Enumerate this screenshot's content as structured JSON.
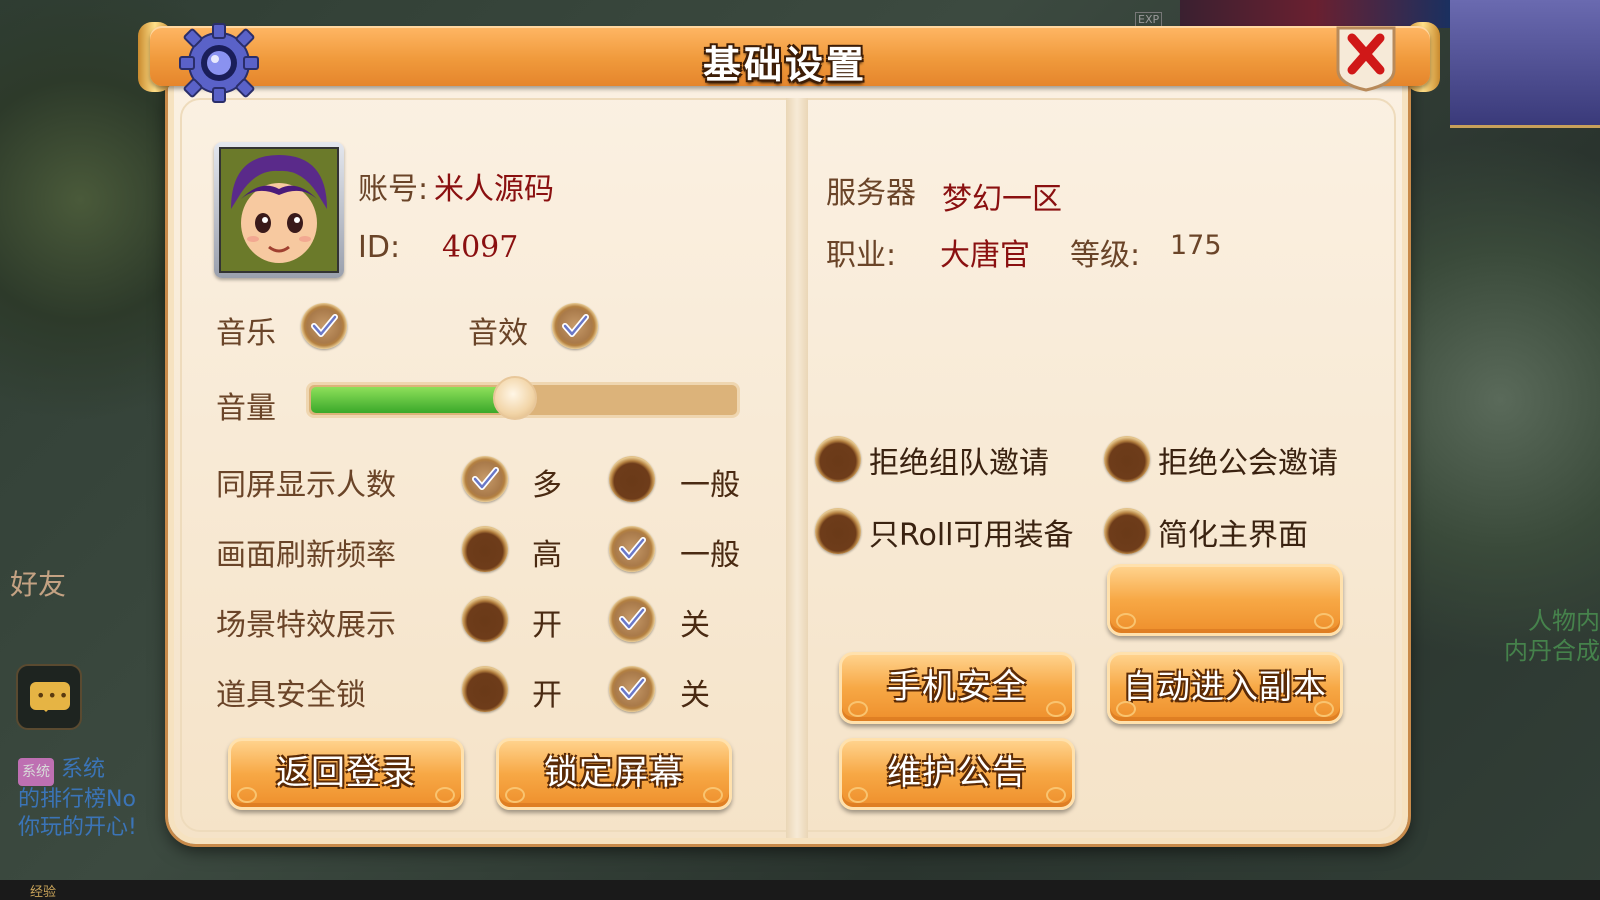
{
  "dialog": {
    "title": "基础设置",
    "close_icon": "close-icon",
    "gear_icon": "gear-icon"
  },
  "account": {
    "account_label": "账号:",
    "account_name": "米人源码",
    "id_label": "ID:",
    "id_value": "4097"
  },
  "server_info": {
    "server_label": "服务器",
    "server_value": "梦幻一区",
    "class_label": "职业:",
    "class_value": "大唐官",
    "level_label": "等级:",
    "level_value": "175"
  },
  "sound": {
    "music_label": "音乐",
    "music_checked": true,
    "sfx_label": "音效",
    "sfx_checked": true,
    "volume_label": "音量",
    "volume_level": 0.48
  },
  "settings_rows": [
    {
      "label": "同屏显示人数",
      "options": [
        {
          "text": "多",
          "checked": true
        },
        {
          "text": "一般",
          "checked": false
        }
      ]
    },
    {
      "label": "画面刷新频率",
      "options": [
        {
          "text": "高",
          "checked": false
        },
        {
          "text": "一般",
          "checked": true
        }
      ]
    },
    {
      "label": "场景特效展示",
      "options": [
        {
          "text": "开",
          "checked": false
        },
        {
          "text": "关",
          "checked": true
        }
      ]
    },
    {
      "label": "道具安全锁",
      "options": [
        {
          "text": "开",
          "checked": false
        },
        {
          "text": "关",
          "checked": true
        }
      ]
    }
  ],
  "right_toggles": [
    {
      "text": "拒绝组队邀请",
      "checked": false
    },
    {
      "text": "拒绝公会邀请",
      "checked": false
    },
    {
      "text": "只Roll可用装备",
      "checked": false
    },
    {
      "text": "简化主界面",
      "checked": false
    }
  ],
  "buttons": {
    "back_login": "返回登录",
    "lock_screen": "锁定屏幕",
    "blank": "",
    "phone_security": "手机安全",
    "auto_dungeon": "自动进入副本",
    "maintenance": "维护公告"
  },
  "hud": {
    "friend": "好友",
    "chat_icon": "chat-icon",
    "system_tag": "系统",
    "system_text_1": "系统",
    "system_text_2": "的排行榜No",
    "system_text_3": "你玩的开心!",
    "exp_label": "经验",
    "exp_tag": "EXP",
    "right_text_1": "人物内",
    "right_text_2": "内丹合成"
  },
  "colors": {
    "label": "#6a4428",
    "value": "#8a1010",
    "button": "#f7a845",
    "volume_fill": "#3aa82a"
  }
}
